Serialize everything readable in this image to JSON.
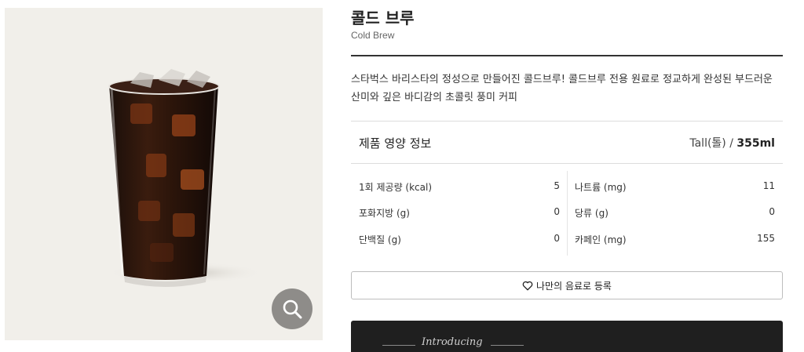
{
  "product": {
    "name_ko": "콜드 브루",
    "name_en": "Cold Brew",
    "description": "스타벅스 바리스타의 정성으로 만들어진 콜드브루! 콜드브루 전용 원료로 정교하게 완성된 부드러운 산미와 깊은 바디감의 초콜릿 풍미 커피"
  },
  "nutrition": {
    "heading": "제품 영양 정보",
    "size_label": "Tall(톨) / ",
    "size_value": "355ml",
    "rows": [
      {
        "left_label": "1회 제공량 (kcal)",
        "left_value": "5",
        "right_label": "나트륨 (mg)",
        "right_value": "11"
      },
      {
        "left_label": "포화지방 (g)",
        "left_value": "0",
        "right_label": "당류 (g)",
        "right_value": "0"
      },
      {
        "left_label": "단백질 (g)",
        "left_value": "0",
        "right_label": "카페인 (mg)",
        "right_value": "155"
      }
    ]
  },
  "actions": {
    "favorite_label": "나만의 음료로 등록",
    "favorite_icon": "heart-outline-icon",
    "zoom_icon": "search-icon"
  },
  "banner": {
    "text": "Introducing"
  },
  "colors": {
    "image_bg": "#f1efea",
    "zoom_bg": "#8e8c89",
    "banner_bg": "#1f1f1f"
  }
}
